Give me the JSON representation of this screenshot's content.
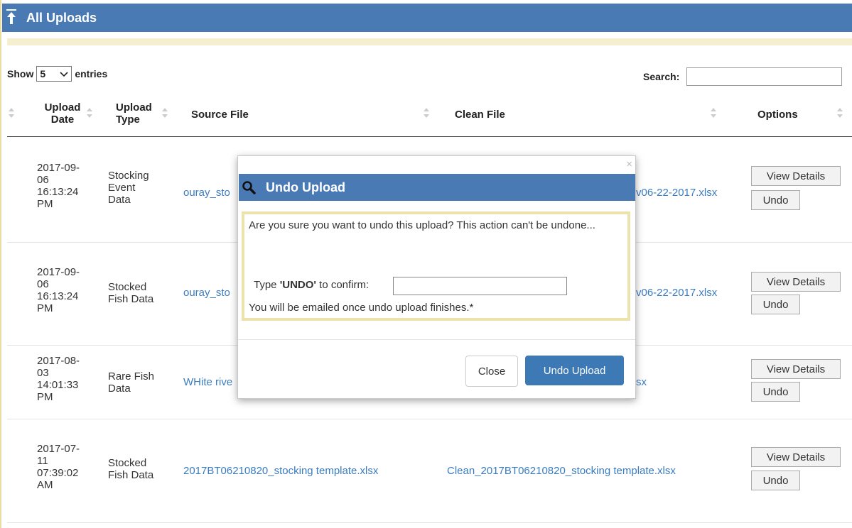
{
  "header": {
    "title": "All Uploads"
  },
  "controls": {
    "show_label": "Show",
    "show_value": "5",
    "entries_label": "entries",
    "search_label": "Search:",
    "search_value": ""
  },
  "table": {
    "columns": [
      "Upload Date",
      "Upload Type",
      "Source File",
      "Clean File",
      "Options"
    ],
    "rows": [
      {
        "date": [
          "2017-09-",
          "06",
          "16:13:24",
          "PM"
        ],
        "type": [
          "Stocking",
          "Event",
          "Data"
        ],
        "source": "ouray_sto",
        "clean": "v06-22-2017.xlsx"
      },
      {
        "date": [
          "2017-09-",
          "06",
          "16:13:24",
          "PM"
        ],
        "type": [
          "Stocked",
          "Fish Data"
        ],
        "source": "ouray_sto",
        "clean": "v06-22-2017.xlsx"
      },
      {
        "date": [
          "2017-08-",
          "03",
          "14:01:33",
          "PM"
        ],
        "type": [
          "Rare Fish",
          "Data"
        ],
        "source": "WHite rive",
        "clean": "sx"
      },
      {
        "date": [
          "2017-07-",
          "11",
          "07:39:02",
          "AM"
        ],
        "type": [
          "Stocked",
          "Fish Data"
        ],
        "source": "2017BT06210820_stocking template.xlsx",
        "clean": "Clean_2017BT06210820_stocking template.xlsx"
      }
    ],
    "view_details_label": "View Details",
    "undo_label": "Undo"
  },
  "modal": {
    "close_x": "×",
    "title": "Undo Upload",
    "question": "Are you sure you want to undo this upload? This action can't be undone...",
    "type_prefix": "Type ",
    "type_keyword": "'UNDO'",
    "type_suffix": " to confirm:",
    "confirm_value": "",
    "email_note": "You will be emailed once undo upload finishes.*",
    "close_label": "Close",
    "undo_label": "Undo Upload"
  },
  "colors": {
    "header_bg": "#4a7ab4",
    "link": "#3a7cc1",
    "primary_button": "#3d79b5",
    "modal_border": "#ece3ac"
  },
  "icons": {
    "header": "upload-arrow-icon",
    "modal": "magnifier-icon"
  }
}
